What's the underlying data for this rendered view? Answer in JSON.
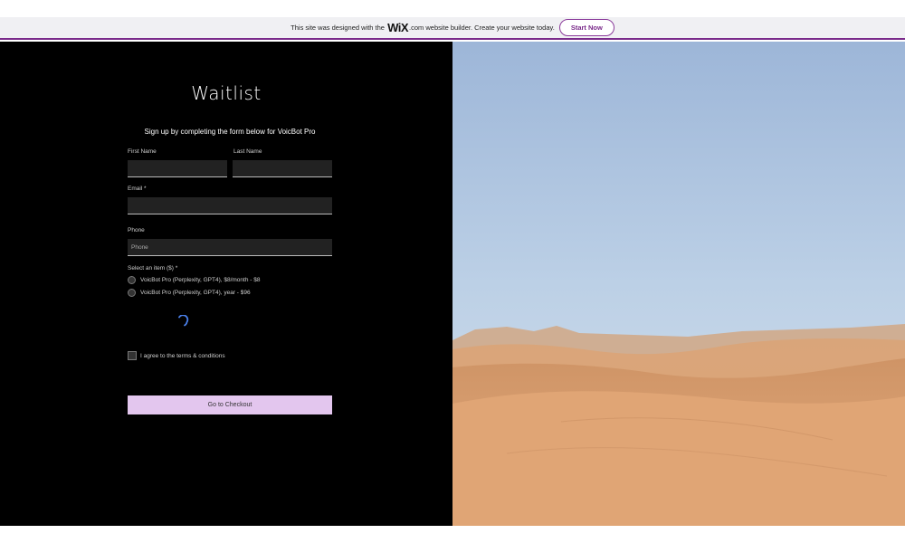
{
  "banner": {
    "text_before": "This site was designed with the",
    "logo": "WiX",
    "text_after": ".com website builder. Create your website today.",
    "button": "Start Now"
  },
  "form": {
    "title": "Waitlist",
    "subtitle": "Sign up by completing the form below for VoicBot Pro",
    "first_name_label": "First Name",
    "last_name_label": "Last Name",
    "email_label": "Email *",
    "phone_label": "Phone",
    "phone_placeholder": "Phone",
    "select_label": "Select an item ($) *",
    "options": [
      "VoicBot Pro (Perplexity, GPT4), $8/month - $8",
      "VoicBot Pro (Perplexity, GPT4), year - $96"
    ],
    "terms_label": "I agree to the terms & conditions",
    "checkout_button": "Go to Checkout"
  },
  "colors": {
    "accent": "#7a2a8a",
    "button_bg": "#e3c6ee",
    "panel_bg": "#000000"
  }
}
